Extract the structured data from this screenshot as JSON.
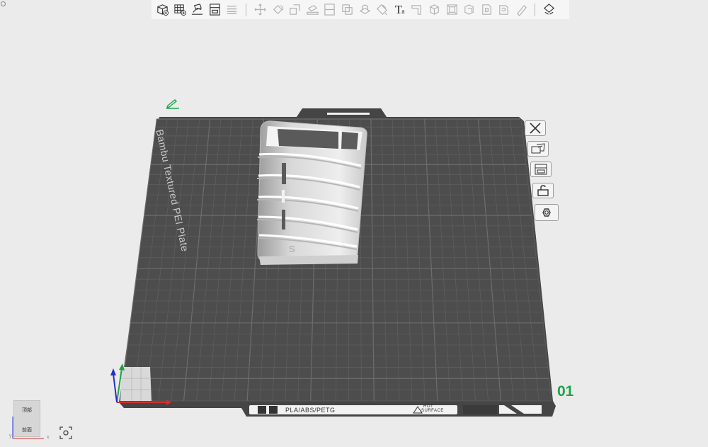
{
  "toolbar": {
    "items": [
      {
        "icon": "add-object-icon",
        "enabled": true
      },
      {
        "icon": "add-plate-icon",
        "enabled": true
      },
      {
        "icon": "auto-orient-icon",
        "enabled": true
      },
      {
        "icon": "arrange-icon",
        "enabled": true
      },
      {
        "icon": "split-plates-icon",
        "enabled": false
      },
      {
        "icon": "move-icon",
        "enabled": false
      },
      {
        "icon": "rotate-icon",
        "enabled": false
      },
      {
        "icon": "scale-icon",
        "enabled": false
      },
      {
        "icon": "lay-on-face-icon",
        "enabled": false
      },
      {
        "icon": "cut-icon",
        "enabled": false
      },
      {
        "icon": "boolean-icon",
        "enabled": false
      },
      {
        "icon": "support-paint-icon",
        "enabled": false
      },
      {
        "icon": "color-paint-icon",
        "enabled": false
      },
      {
        "icon": "text-icon",
        "enabled": true
      },
      {
        "icon": "measure-icon",
        "enabled": false
      },
      {
        "icon": "assembly-icon",
        "enabled": false
      },
      {
        "icon": "mesh-boolean-icon",
        "enabled": false
      },
      {
        "icon": "explode-icon",
        "enabled": false
      },
      {
        "icon": "clone-icon",
        "enabled": false
      },
      {
        "icon": "variable-layer-icon",
        "enabled": false
      },
      {
        "icon": "brim-ears-icon",
        "enabled": false
      },
      {
        "icon": "edit-plate-icon",
        "enabled": true
      }
    ],
    "text_icon_label": "T",
    "text_icon_sub": "a"
  },
  "plate": {
    "name": "Bambu Textured PEI Plate",
    "number": "01",
    "filament_label": "PLA/ABS/PETG",
    "hot_surface_label_1": "HOT",
    "hot_surface_label_2": "SURFACE",
    "side_buttons": [
      {
        "icon": "close-plate-icon"
      },
      {
        "icon": "plate-settings-icon"
      },
      {
        "icon": "arrange-plate-icon"
      },
      {
        "icon": "lock-plate-icon"
      },
      {
        "icon": "plate-gear-icon"
      }
    ]
  },
  "model": {
    "label": "S"
  },
  "nav_cube": {
    "top_label": "顶部",
    "front_label": "前面",
    "axis_x": "x",
    "axis_y": "y"
  },
  "colors": {
    "background": "#ebebeb",
    "plate": "#4a4a4a",
    "plate_number": "#1aa54a",
    "model": "#e6e6e6",
    "axis_x": "#d23131",
    "axis_y": "#23a046",
    "axis_z": "#2030c8"
  }
}
